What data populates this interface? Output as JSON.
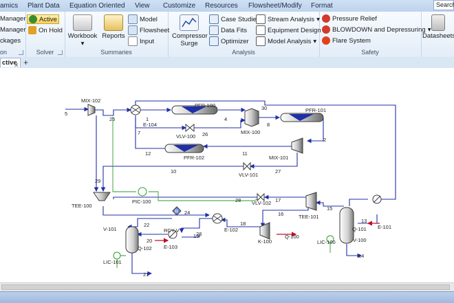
{
  "menu": {
    "items": [
      "amics",
      "Plant Data",
      "Equation Oriented",
      "View",
      "Customize",
      "Resources",
      "Flowsheet/Modify",
      "Format"
    ],
    "search_placeholder": "Search"
  },
  "ribbon": {
    "col0": [
      "Manager",
      "Manager",
      "ckages"
    ],
    "col0_label": "on",
    "solver": {
      "active": "Active",
      "on_hold": "On Hold",
      "label": "Solver"
    },
    "summaries": {
      "workbook": "Workbook",
      "reports": "Reports",
      "model": "Model",
      "flowsheet": "Flowsheet",
      "input": "Input",
      "label": "Summaries"
    },
    "analysis": {
      "compressor": "Compressor Surge",
      "case_studies": "Case Studies",
      "data_fits": "Data Fits",
      "optimizer": "Optimizer",
      "stream_analysis": "Stream Analysis",
      "equipment_design": "Equipment Design",
      "model_analysis": "Model Analysis",
      "label": "Analysis"
    },
    "safety": {
      "pressure_relief": "Pressure Relief",
      "blowdown": "BLOWDOWN and Depressuring",
      "flare": "Flare System",
      "label": "Safety"
    },
    "datasheets": "Datasheets"
  },
  "tabs": [
    {
      "label": "ctive"
    }
  ],
  "flowsheet": {
    "labels": {
      "mix102": "MIX-102",
      "s5": "5",
      "s25": "25",
      "s1": "1",
      "e104": "E-104",
      "pfr100": "PFR-100",
      "s30": "30",
      "pfr101": "PFR-101",
      "s4": "4",
      "mix100": "MIX-100",
      "s8": "8",
      "s7": "7",
      "vlv100": "VLV-100",
      "s26": "26",
      "s2": "2",
      "s12": "12",
      "pfr102": "PFR-102",
      "s11": "11",
      "mix101": "MIX-101",
      "s10": "10",
      "vlv101": "VLV-101",
      "s27": "27",
      "s29": "29",
      "tee100": "TEE-100",
      "pic100": "PIC-100",
      "s28": "28",
      "vlv102": "VLV-102",
      "s17": "17",
      "s24": "24",
      "s16": "16",
      "tee101": "TEE-101",
      "s15": "15",
      "s13": "13",
      "q101": "Q-101",
      "e101": "E-101",
      "v101": "V-101",
      "s22": "22",
      "rcyv": "RCY-V",
      "s18": "18",
      "e102": "E-102",
      "s20": "20",
      "s19": "19",
      "s23": "23",
      "q102": "Q-102",
      "e103": "E-103",
      "k100": "K-100",
      "q100": "Q-100",
      "lic100": "LIC-100",
      "v100": "V-100",
      "s14": "14",
      "lic101": "LIC-101",
      "s21": "21"
    }
  },
  "colors": {
    "stream": "#1f2fa8",
    "energy": "#c0102a",
    "signal": "#2e9a2e",
    "unit": "#3a3a3a"
  }
}
